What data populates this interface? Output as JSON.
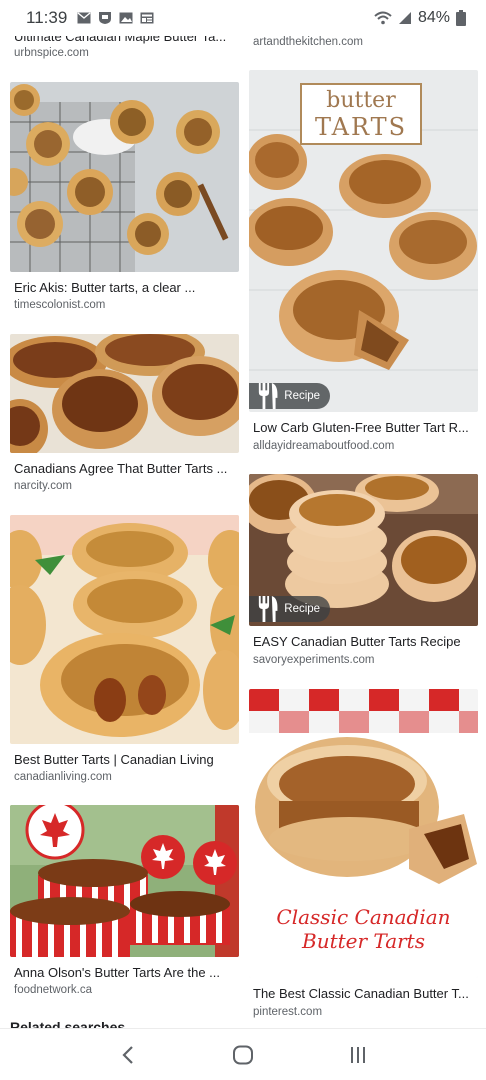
{
  "status_bar": {
    "time": "11:39",
    "battery": "84%",
    "icons_left": [
      "gmail-icon",
      "nfl-icon",
      "gallery-icon",
      "news-icon"
    ],
    "icons_right": [
      "wifi-icon",
      "signal-icon",
      "battery-icon"
    ]
  },
  "results": {
    "left": [
      {
        "title": "Ultimate Canadian Maple Butter Ta...",
        "source": "urbnspice.com"
      },
      {
        "title": "Eric Akis: Butter tarts, a clear ...",
        "source": "timescolonist.com"
      },
      {
        "title": "Canadians Agree That Butter Tarts ...",
        "source": "narcity.com"
      },
      {
        "title": "Best Butter Tarts | Canadian Living",
        "source": "canadianliving.com"
      },
      {
        "title": "Anna Olson's Butter Tarts Are the ...",
        "source": "foodnetwork.ca"
      }
    ],
    "right": [
      {
        "title": "",
        "source": "artandthekitchen.com"
      },
      {
        "title": "Low Carb Gluten-Free Butter Tart R...",
        "source": "alldayidreamaboutfood.com",
        "badge": "Recipe",
        "image_text": [
          "butter",
          "TARTS"
        ]
      },
      {
        "title": "EASY Canadian Butter Tarts Recipe",
        "source": "savoryexperiments.com",
        "badge": "Recipe"
      },
      {
        "title": "The Best Classic Canadian Butter T...",
        "source": "pinterest.com",
        "image_text": [
          "Classic Canadian",
          "Butter Tarts"
        ]
      }
    ]
  },
  "related_heading": "Related searches",
  "nav_bar": {
    "buttons": [
      "back-button",
      "home-button",
      "recents-button"
    ]
  },
  "colors": {
    "source_text": "#5f6368",
    "title_text": "#202124",
    "badge_bg": "#3c4043",
    "accent_red": "#d62828"
  }
}
